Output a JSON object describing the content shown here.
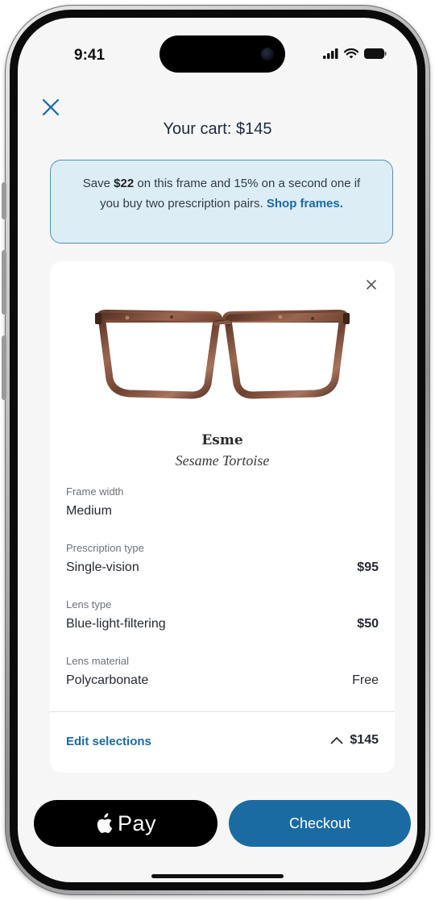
{
  "status_bar": {
    "time": "9:41",
    "icons": [
      "signal-icon",
      "wifi-icon",
      "battery-icon"
    ]
  },
  "header": {
    "close_icon": "close-icon",
    "title": "Your cart: $145"
  },
  "promo": {
    "prefix": "Save ",
    "amount": "$22",
    "middle": " on this frame and 15% on a second one if you buy two prescription pairs. ",
    "link": "Shop frames."
  },
  "product": {
    "name": "Esme",
    "color": "Sesame Tortoise",
    "remove_icon": "close-icon",
    "image_icon": "eyeglasses-image",
    "options": [
      {
        "label": "Frame width",
        "value": "Medium",
        "price": ""
      },
      {
        "label": "Prescription type",
        "value": "Single-vision",
        "price": "$95"
      },
      {
        "label": "Lens type",
        "value": "Blue-light-filtering",
        "price": "$50"
      },
      {
        "label": "Lens material",
        "value": "Polycarbonate",
        "price": "Free"
      }
    ],
    "edit_label": "Edit selections",
    "total": "$145",
    "total_icon": "chevron-up-icon"
  },
  "actions": {
    "applepay_label": "Pay",
    "applepay_icon": "apple-logo-icon",
    "checkout_label": "Checkout"
  },
  "colors": {
    "accent": "#1b6ba3",
    "link": "#1a6aa3",
    "promo_bg": "#dcedf5",
    "promo_border": "#4f91b6",
    "screen_bg": "#f6f6f6"
  }
}
